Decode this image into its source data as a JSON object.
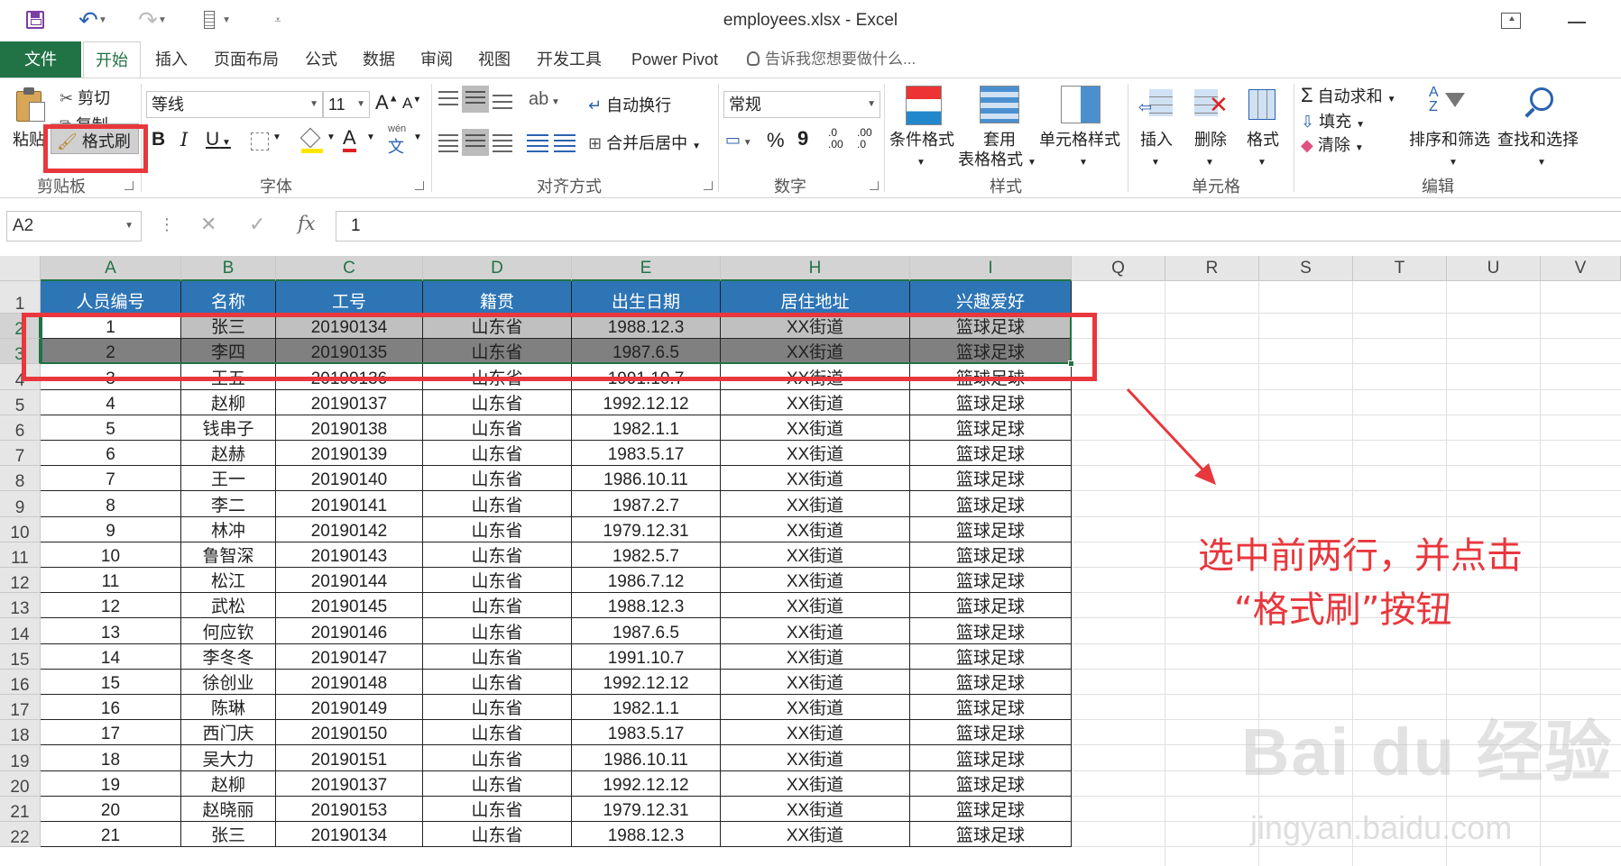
{
  "window": {
    "title": "employees.xlsx - Excel"
  },
  "tabs": [
    "文件",
    "开始",
    "插入",
    "页面布局",
    "公式",
    "数据",
    "审阅",
    "视图",
    "开发工具",
    "Power Pivot"
  ],
  "tell_me": "告诉我您想要做什么...",
  "ribbon": {
    "clipboard": {
      "label": "剪贴板",
      "paste": "粘贴",
      "cut": "剪切",
      "copy": "复制",
      "format_painter": "格式刷"
    },
    "font": {
      "label": "字体",
      "font_name": "等线",
      "font_size": "11",
      "bold": "B",
      "italic": "I",
      "underline": "U",
      "font_color": "A",
      "grow": "A",
      "shrink": "A",
      "wen": "wén",
      "wen_char": "文"
    },
    "alignment": {
      "label": "对齐方式",
      "wrap_text": "自动换行",
      "merge_center": "合并后居中"
    },
    "number": {
      "label": "数字",
      "format": "常规",
      "percent": "%",
      "comma": "9",
      "inc": ".0 .00",
      "dec": ".00 .0"
    },
    "styles": {
      "label": "样式",
      "cond_format": "条件格式",
      "table_format_1": "套用",
      "table_format_2": "表格格式",
      "cell_styles": "单元格样式"
    },
    "cells": {
      "label": "单元格",
      "insert": "插入",
      "delete": "删除",
      "format": "格式"
    },
    "editing": {
      "label": "编辑",
      "autosum": "自动求和",
      "fill": "填充",
      "clear": "清除",
      "sort_filter": "排序和筛选",
      "find_select": "查找和选择"
    }
  },
  "formula_bar": {
    "name_box": "A2",
    "fx": "fx",
    "value": "1"
  },
  "columns": {
    "table": [
      "A",
      "B",
      "C",
      "D",
      "E",
      "H",
      "I"
    ],
    "extra": [
      "Q",
      "R",
      "S",
      "T",
      "U",
      "V"
    ]
  },
  "rows": [
    "1",
    "2",
    "3",
    "4",
    "5",
    "6",
    "7",
    "8",
    "9",
    "10",
    "11",
    "12",
    "13",
    "14",
    "15",
    "16",
    "17",
    "18",
    "19",
    "20",
    "21",
    "22"
  ],
  "table": {
    "headers": [
      "人员编号",
      "名称",
      "工号",
      "籍贯",
      "出生日期",
      "居住地址",
      "兴趣爱好"
    ],
    "data": [
      [
        "1",
        "张三",
        "20190134",
        "山东省",
        "1988.12.3",
        "XX街道",
        "篮球足球"
      ],
      [
        "2",
        "李四",
        "20190135",
        "山东省",
        "1987.6.5",
        "XX街道",
        "篮球足球"
      ],
      [
        "3",
        "王五",
        "20190136",
        "山东省",
        "1991.10.7",
        "XX街道",
        "篮球足球"
      ],
      [
        "4",
        "赵柳",
        "20190137",
        "山东省",
        "1992.12.12",
        "XX街道",
        "篮球足球"
      ],
      [
        "5",
        "钱串子",
        "20190138",
        "山东省",
        "1982.1.1",
        "XX街道",
        "篮球足球"
      ],
      [
        "6",
        "赵赫",
        "20190139",
        "山东省",
        "1983.5.17",
        "XX街道",
        "篮球足球"
      ],
      [
        "7",
        "王一",
        "20190140",
        "山东省",
        "1986.10.11",
        "XX街道",
        "篮球足球"
      ],
      [
        "8",
        "李二",
        "20190141",
        "山东省",
        "1987.2.7",
        "XX街道",
        "篮球足球"
      ],
      [
        "9",
        "林冲",
        "20190142",
        "山东省",
        "1979.12.31",
        "XX街道",
        "篮球足球"
      ],
      [
        "10",
        "鲁智深",
        "20190143",
        "山东省",
        "1982.5.7",
        "XX街道",
        "篮球足球"
      ],
      [
        "11",
        "松江",
        "20190144",
        "山东省",
        "1986.7.12",
        "XX街道",
        "篮球足球"
      ],
      [
        "12",
        "武松",
        "20190145",
        "山东省",
        "1988.12.3",
        "XX街道",
        "篮球足球"
      ],
      [
        "13",
        "何应钦",
        "20190146",
        "山东省",
        "1987.6.5",
        "XX街道",
        "篮球足球"
      ],
      [
        "14",
        "李冬冬",
        "20190147",
        "山东省",
        "1991.10.7",
        "XX街道",
        "篮球足球"
      ],
      [
        "15",
        "徐创业",
        "20190148",
        "山东省",
        "1992.12.12",
        "XX街道",
        "篮球足球"
      ],
      [
        "16",
        "陈琳",
        "20190149",
        "山东省",
        "1982.1.1",
        "XX街道",
        "篮球足球"
      ],
      [
        "17",
        "西门庆",
        "20190150",
        "山东省",
        "1983.5.17",
        "XX街道",
        "篮球足球"
      ],
      [
        "18",
        "吴大力",
        "20190151",
        "山东省",
        "1986.10.11",
        "XX街道",
        "篮球足球"
      ],
      [
        "19",
        "赵柳",
        "20190137",
        "山东省",
        "1992.12.12",
        "XX街道",
        "篮球足球"
      ],
      [
        "20",
        "赵晓丽",
        "20190153",
        "山东省",
        "1979.12.31",
        "XX街道",
        "篮球足球"
      ],
      [
        "21",
        "张三",
        "20190134",
        "山东省",
        "1988.12.3",
        "XX街道",
        "篮球足球"
      ]
    ]
  },
  "annotation": {
    "line1": "选中前两行，并点击",
    "line2": "“格式刷”按钮"
  },
  "watermark": {
    "main": "Bai du 经验",
    "sub": "jingyan.baidu.com"
  },
  "colors": {
    "excel_green": "#217346",
    "header_blue": "#2e75b6",
    "annotation_red": "#e8373d",
    "row2_fill": "#c0c0c0",
    "row3_fill": "#808080"
  }
}
